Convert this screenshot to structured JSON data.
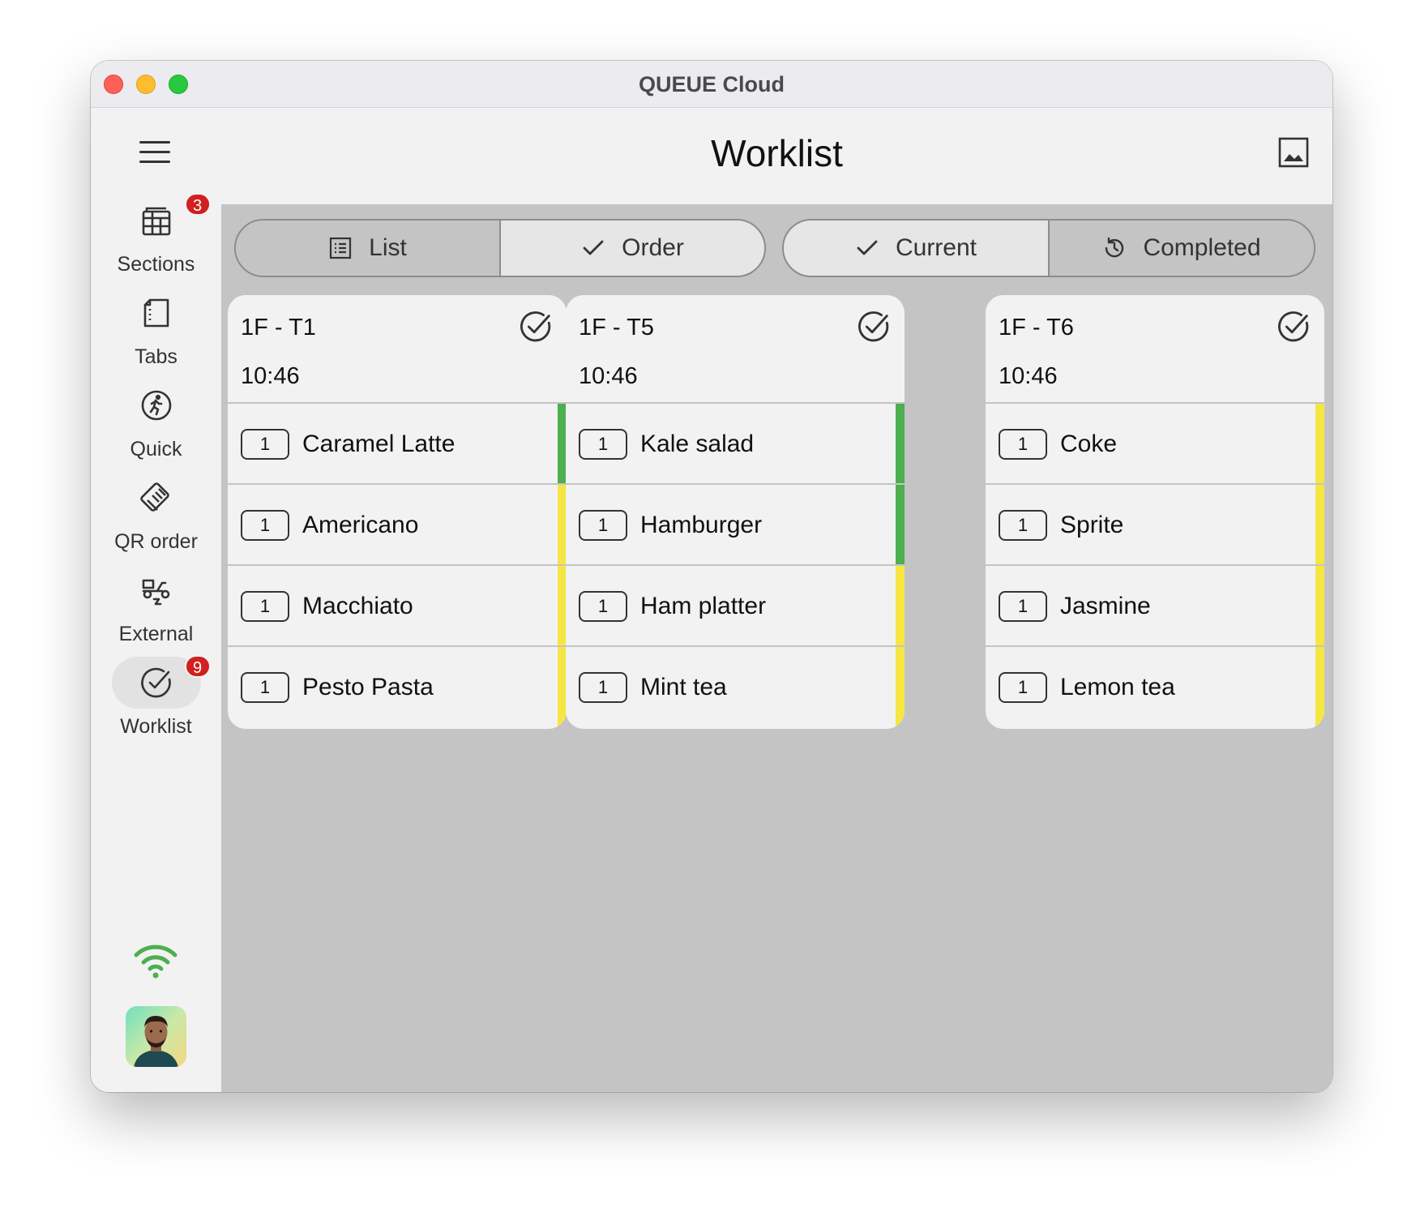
{
  "window": {
    "title": "QUEUE Cloud"
  },
  "header": {
    "title": "Worklist",
    "image_icon": "image-icon"
  },
  "sidebar": {
    "menu_icon": "hamburger-icon",
    "items": [
      {
        "label": "Sections",
        "icon": "table-grid-icon",
        "badge": "3"
      },
      {
        "label": "Tabs",
        "icon": "document-icon"
      },
      {
        "label": "Quick",
        "icon": "running-person-icon"
      },
      {
        "label": "QR order",
        "icon": "handshake-icon"
      },
      {
        "label": "External",
        "icon": "delivery-scooter-icon"
      },
      {
        "label": "Worklist",
        "icon": "check-circle-icon",
        "badge": "9",
        "active": true
      }
    ],
    "wifi_icon": "wifi-icon",
    "wifi_color": "#4caf50"
  },
  "toggles": {
    "view": {
      "list": "List",
      "order": "Order",
      "selected": "order"
    },
    "status": {
      "current": "Current",
      "completed": "Completed",
      "selected": "current"
    }
  },
  "colors": {
    "green": "#4caf50",
    "yellow": "#f5e642",
    "badge": "#d21f1f"
  },
  "cards": [
    {
      "table": "1F - T1",
      "time": "10:46",
      "items": [
        {
          "qty": "1",
          "name": "Caramel Latte",
          "status": "green"
        },
        {
          "qty": "1",
          "name": "Americano",
          "status": "yellow"
        },
        {
          "qty": "1",
          "name": "Macchiato",
          "status": "yellow"
        },
        {
          "qty": "1",
          "name": "Pesto Pasta",
          "status": "yellow"
        }
      ]
    },
    {
      "table": "1F - T5",
      "time": "10:46",
      "items": [
        {
          "qty": "1",
          "name": "Kale salad",
          "status": "green"
        },
        {
          "qty": "1",
          "name": "Hamburger",
          "status": "green"
        },
        {
          "qty": "1",
          "name": "Ham platter",
          "status": "yellow"
        },
        {
          "qty": "1",
          "name": "Mint tea",
          "status": "yellow"
        }
      ]
    },
    {
      "table": "1F - T6",
      "time": "10:46",
      "items": [
        {
          "qty": "1",
          "name": "Coke",
          "status": "yellow"
        },
        {
          "qty": "1",
          "name": "Sprite",
          "status": "yellow"
        },
        {
          "qty": "1",
          "name": "Jasmine",
          "status": "yellow"
        },
        {
          "qty": "1",
          "name": "Lemon tea",
          "status": "yellow"
        }
      ]
    }
  ]
}
